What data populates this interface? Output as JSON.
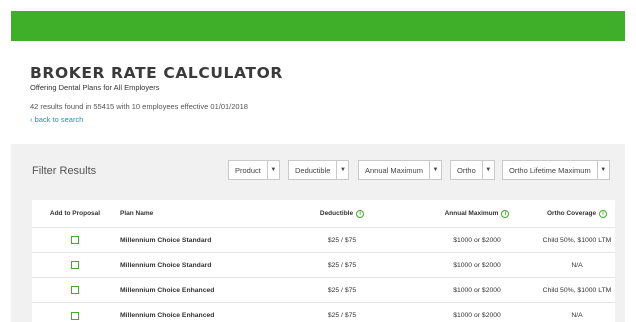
{
  "header": {
    "title": "BROKER RATE CALCULATOR",
    "subtitle": "Offering Dental Plans for All Employers",
    "results_text": "42 results found in 55415 with 10 employees effective 01/01/2018",
    "back_link": "‹ back to search"
  },
  "filters": {
    "title": "Filter Results",
    "items": [
      {
        "label": "Product"
      },
      {
        "label": "Deductible"
      },
      {
        "label": "Annual Maximum"
      },
      {
        "label": "Ortho"
      },
      {
        "label": "Ortho Lifetime Maximum"
      }
    ]
  },
  "table": {
    "headers": {
      "add": "Add to Proposal",
      "name": "Plan Name",
      "deductible": "Deductible",
      "annual": "Annual Maximum",
      "ortho": "Ortho Coverage"
    },
    "rows": [
      {
        "name": "Millennium Choice Standard",
        "deductible": "$25 / $75",
        "annual": "$1000 or $2000",
        "ortho": "Child 50%, $1000 LTM"
      },
      {
        "name": "Millennium Choice Standard",
        "deductible": "$25 / $75",
        "annual": "$1000 or $2000",
        "ortho": "N/A"
      },
      {
        "name": "Millennium Choice Enhanced",
        "deductible": "$25 / $75",
        "annual": "$1000 or $2000",
        "ortho": "Child 50%, $1000 LTM"
      },
      {
        "name": "Millennium Choice Enhanced",
        "deductible": "$25 / $75",
        "annual": "$1000 or $2000",
        "ortho": "N/A"
      }
    ]
  },
  "colors": {
    "brand_green": "#3fae29",
    "link_blue": "#2a8fb6",
    "panel_gray": "#f1f1f1"
  }
}
